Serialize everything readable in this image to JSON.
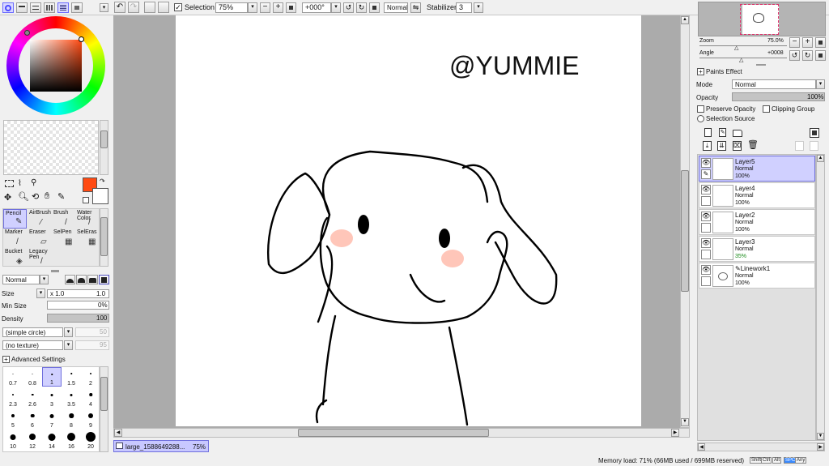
{
  "toolbar": {
    "selection_label": "Selection",
    "zoom_value": "75%",
    "angle_value": "+000°",
    "blend_value": "Normal",
    "stabilizer_label": "Stabilizer",
    "stabilizer_value": "3"
  },
  "tools": {
    "items": [
      {
        "label": "Pencil",
        "icon": "pencil-icon"
      },
      {
        "label": "AirBrush",
        "icon": "airbrush-icon"
      },
      {
        "label": "Brush",
        "icon": "brush-icon"
      },
      {
        "label": "Water Color",
        "icon": "watercolor-icon"
      },
      {
        "label": "Marker",
        "icon": "marker-icon"
      },
      {
        "label": "Eraser",
        "icon": "eraser-icon"
      },
      {
        "label": "SelPen",
        "icon": "selpen-icon"
      },
      {
        "label": "SelEras",
        "icon": "seleras-icon"
      },
      {
        "label": "Bucket",
        "icon": "bucket-icon"
      },
      {
        "label": "Legacy Pen",
        "icon": "legacy-pen-icon"
      }
    ]
  },
  "brush": {
    "blend_mode": "Normal",
    "size_label": "Size",
    "size_multiplier": "x 1.0",
    "size_value": "1.0",
    "min_size_label": "Min Size",
    "min_size_value": "0%",
    "density_label": "Density",
    "density_value": "100",
    "shape": "(simple circle)",
    "shape_value": "50",
    "texture": "(no texture)",
    "texture_value": "95",
    "advanced_label": "Advanced Settings"
  },
  "brush_sizes": [
    "0.7",
    "0.8",
    "1",
    "1.5",
    "2",
    "2.3",
    "2.6",
    "3",
    "3.5",
    "4",
    "5",
    "6",
    "7",
    "8",
    "9",
    "10",
    "12",
    "14",
    "16",
    "20"
  ],
  "canvas": {
    "watermark": "@YUMMIE",
    "tab_name": "large_1588649288...",
    "tab_zoom": "75%"
  },
  "navigator": {
    "zoom_label": "Zoom",
    "zoom_value": "75.0%",
    "angle_label": "Angle",
    "angle_value": "+0008"
  },
  "layers_panel": {
    "paints_effect_label": "Paints Effect",
    "mode_label": "Mode",
    "mode_value": "Normal",
    "opacity_label": "Opacity",
    "opacity_value": "100%",
    "preserve_opacity_label": "Preserve Opacity",
    "clipping_group_label": "Clipping Group",
    "selection_source_label": "Selection Source",
    "layers": [
      {
        "name": "Layer5",
        "mode": "Normal",
        "opacity": "100%",
        "selected": true
      },
      {
        "name": "Layer4",
        "mode": "Normal",
        "opacity": "100%",
        "selected": false
      },
      {
        "name": "Layer2",
        "mode": "Normal",
        "opacity": "100%",
        "selected": false
      },
      {
        "name": "Layer3",
        "mode": "Normal",
        "opacity": "35%",
        "selected": false
      },
      {
        "name": "Linework1",
        "mode": "Normal",
        "opacity": "100%",
        "selected": false
      }
    ]
  },
  "status": {
    "memory": "Memory load: 71% (66MB used / 699MB reserved)",
    "keys": [
      "Shift",
      "Ctrl",
      "Alt",
      "SPC",
      "Any"
    ]
  },
  "colors": {
    "primary": "#ff4a12",
    "selection_blue": "#c8c8ff",
    "canvas_bg": "#ababab"
  }
}
